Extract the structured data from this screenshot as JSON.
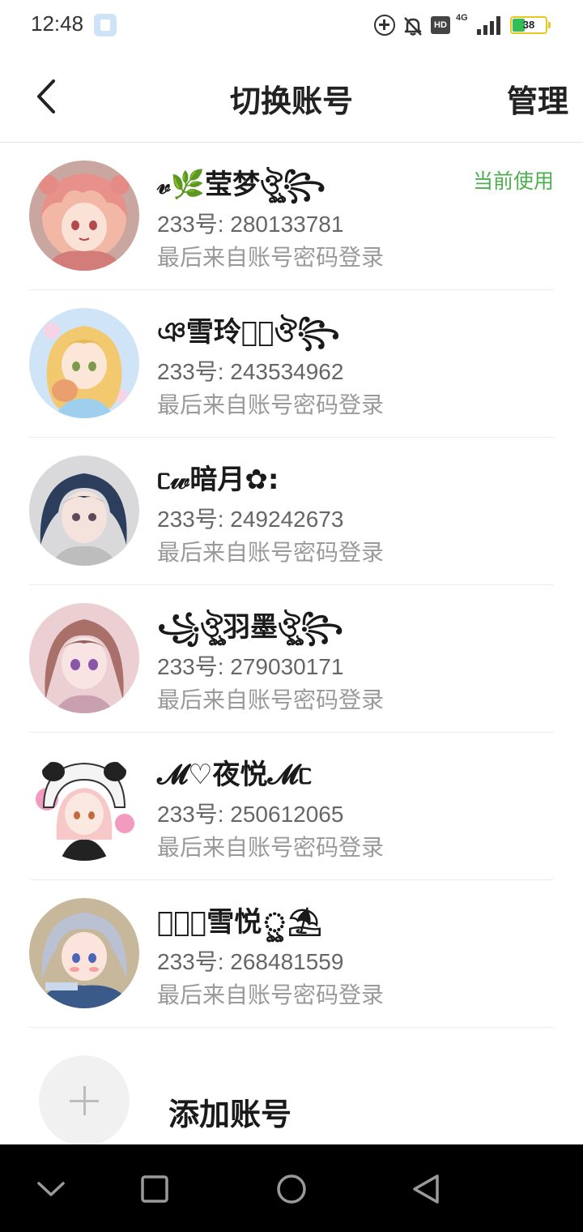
{
  "status_bar": {
    "time": "12:48",
    "network": "4G",
    "hd": "HD",
    "battery_percent": 38,
    "battery_text": "38"
  },
  "header": {
    "title": "切换账号",
    "manage_label": "管理",
    "back_icon": "chevron-left-icon"
  },
  "accounts": [
    {
      "name": "𝓋🌿莹梦ঔৣ꧂",
      "id_text": "233号: 280133781",
      "login_text": "最后来自账号密码登录",
      "current_label": "当前使用"
    },
    {
      "name": "ঞ雪玲ৃ͙ঔ꧂",
      "id_text": "233号: 243534962",
      "login_text": "最后来自账号密码登录"
    },
    {
      "name": "ᥴ𝓌暗月✿:",
      "id_text": "233号: 249242673",
      "login_text": "最后来自账号密码登录"
    },
    {
      "name": "꧁ঔৣ羽墨ঔৣ꧂",
      "id_text": "233号: 279030171",
      "login_text": "最后来自账号密码登录"
    },
    {
      "name": "𝓜♡夜悦𝓜ᥴ",
      "id_text": "233号: 250612065",
      "login_text": "最后来自账号密码登录"
    },
    {
      "name": "ঔৣ͙雪悦ৣ⛱",
      "id_text": "233号: 268481559",
      "login_text": "最后来自账号密码登录"
    }
  ],
  "add_account": {
    "label": "添加账号",
    "icon": "plus-icon"
  },
  "nav_bar": {
    "icons": [
      "chevron-down-icon",
      "recents-square-icon",
      "home-circle-icon",
      "back-triangle-icon"
    ]
  },
  "colors": {
    "accent_green": "#4caf50",
    "battery_fill": "#2fbf55",
    "nav_background": "#000000"
  }
}
